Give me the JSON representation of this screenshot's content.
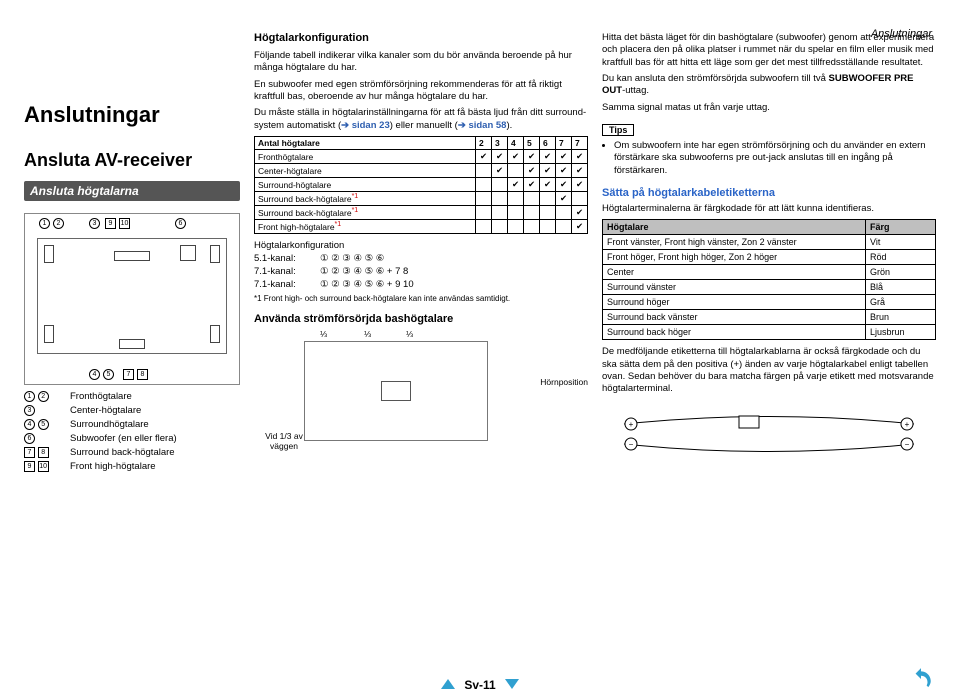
{
  "header_right": "Anslutningar",
  "left": {
    "title": "Anslutningar",
    "sub": "Ansluta AV-receiver",
    "bar": "Ansluta högtalarna",
    "enum_top": {
      "a": "1",
      "b": "2",
      "c": "3",
      "d": "9",
      "e": "10",
      "f": "6"
    },
    "enum_bot": {
      "a": "4",
      "b": "5",
      "c": "7",
      "d": "8"
    },
    "legend": [
      {
        "nums": "① ②",
        "txt": "Fronthögtalare"
      },
      {
        "nums": "③",
        "txt": "Center-högtalare"
      },
      {
        "nums": "④ ⑤",
        "txt": "Surroundhögtalare"
      },
      {
        "nums": "⑥",
        "txt": "Subwoofer (en eller flera)"
      },
      {
        "nums": "7 8",
        "txt": "Surround back-högtalare",
        "sq": true
      },
      {
        "nums": "9 10",
        "txt": "Front high-högtalare",
        "sq": true
      }
    ]
  },
  "mid": {
    "mh": "Högtalarkonfiguration",
    "p1": "Följande tabell indikerar vilka kanaler som du bör använda beroende på hur många högtalare du har.",
    "p2": "En subwoofer med egen strömförsörjning rekommenderas för att få riktigt kraftfull bas, oberoende av hur många högtalare du har.",
    "p3a": "Du måste ställa in högtalarinställningarna för att få bästa ljud från ditt surround-system automatiskt (",
    "p3link1": "➔ sidan 23",
    "p3b": ") eller manuellt (",
    "p3link2": "➔ sidan 58",
    "p3c": ").",
    "tblhead": "Antal högtalare",
    "cols": [
      "2",
      "3",
      "4",
      "5",
      "6",
      "7",
      "7"
    ],
    "rows": [
      {
        "n": "Fronthögtalare",
        "v": [
          "✔",
          "✔",
          "✔",
          "✔",
          "✔",
          "✔",
          "✔"
        ]
      },
      {
        "n": "Center-högtalare",
        "v": [
          "",
          "✔",
          "",
          "✔",
          "✔",
          "✔",
          "✔"
        ]
      },
      {
        "n": "Surround-högtalare",
        "v": [
          "",
          "",
          "✔",
          "✔",
          "✔",
          "✔",
          "✔"
        ]
      },
      {
        "n": "Surround back-högtalare",
        "sup": "*1",
        "v": [
          "",
          "",
          "",
          "",
          "",
          "✔",
          ""
        ]
      },
      {
        "n": "Surround back-högtalare",
        "sup": "*1",
        "v": [
          "",
          "",
          "",
          "",
          "",
          "",
          "✔"
        ]
      },
      {
        "n": "Front high-högtalare",
        "sup": "*1",
        "v": [
          "",
          "",
          "",
          "",
          "",
          "",
          "✔"
        ]
      }
    ],
    "cfgh": "Högtalarkonfiguration",
    "cfg": [
      {
        "l": "5.1-kanal:",
        "v": "① ② ③ ④ ⑤ ⑥"
      },
      {
        "l": "7.1-kanal:",
        "v": "① ② ③ ④ ⑤ ⑥ + 7 8"
      },
      {
        "l": "7.1-kanal:",
        "v": "① ② ③ ④ ⑤ ⑥ + 9 10"
      }
    ],
    "fn": "*1 Front high- och surround back-högtalare kan inte användas samtidigt.",
    "mh2": "Använda strömförsörjda bashögtalare",
    "sd_corner": "Hörnposition",
    "sd_third": "Vid 1/3 av väggen",
    "fracs": [
      "⅓",
      "⅓",
      "⅓"
    ]
  },
  "right": {
    "p1": "Hitta det bästa läget för din bashögtalare (subwoofer) genom att experimentera och placera den på olika platser i rummet när du spelar en film eller musik med kraftfull bas för att hitta ett läge som ger det mest tillfredsställande resultatet.",
    "p2a": "Du kan ansluta den strömförsörjda subwoofern till två ",
    "p2b": "SUBWOOFER PRE OUT",
    "p2c": "-uttag.",
    "p3": "Samma signal matas ut från varje uttag.",
    "tips": "Tips",
    "bul": "Om subwoofern inte har egen strömförsörjning och du använder en extern förstärkare ska subwooferns pre out-jack anslutas till en ingång på förstärkaren.",
    "rh1": "Sätta på högtalarkabeletiketterna",
    "p4": "Högtalarterminalerna är färgkodade för att lätt kunna identifieras.",
    "ctblh1": "Högtalare",
    "ctblh2": "Färg",
    "ctbl": [
      {
        "a": "Front vänster, Front high vänster, Zon 2 vänster",
        "b": "Vit"
      },
      {
        "a": "Front höger, Front high höger, Zon 2 höger",
        "b": "Röd"
      },
      {
        "a": "Center",
        "b": "Grön"
      },
      {
        "a": "Surround vänster",
        "b": "Blå"
      },
      {
        "a": "Surround höger",
        "b": "Grå"
      },
      {
        "a": "Surround back vänster",
        "b": "Brun"
      },
      {
        "a": "Surround back höger",
        "b": "Ljusbrun"
      }
    ],
    "p5": "De medföljande etiketterna till högtalarkablarna är också färgkodade och du ska sätta dem på den positiva (+) änden av varje högtalarkabel enligt tabellen ovan. Sedan behöver du bara matcha färgen på varje etikett med motsvarande högtalarterminal."
  },
  "footer": "Sv-11"
}
